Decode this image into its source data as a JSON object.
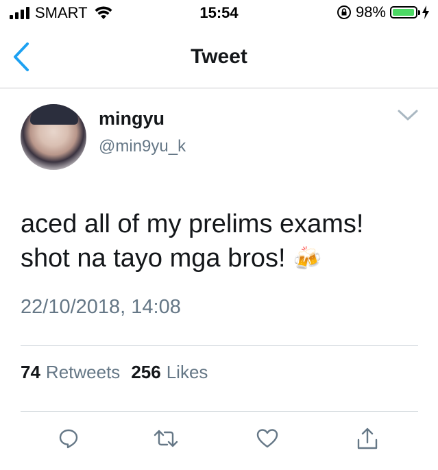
{
  "status_bar": {
    "carrier": "SMART",
    "time": "15:54",
    "battery_percent": "98%",
    "battery_level": 0.98,
    "battery_color": "#4cd964"
  },
  "nav": {
    "title": "Tweet",
    "back_icon": "chevron-left-icon",
    "accent": "#1da1f2"
  },
  "tweet": {
    "author_name": "mingyu",
    "author_handle": "@min9yu_k",
    "text_line1": "aced all of my prelims exams!",
    "text_line2": "shot na tayo mga bros!",
    "emoji": "🍻",
    "timestamp": "22/10/2018, 14:08",
    "retweet_count": "74",
    "retweet_label": "Retweets",
    "like_count": "256",
    "like_label": "Likes"
  },
  "actions": [
    {
      "name": "reply",
      "icon": "comment-icon"
    },
    {
      "name": "retweet",
      "icon": "retweet-icon"
    },
    {
      "name": "like",
      "icon": "heart-icon"
    },
    {
      "name": "share",
      "icon": "share-icon"
    }
  ]
}
